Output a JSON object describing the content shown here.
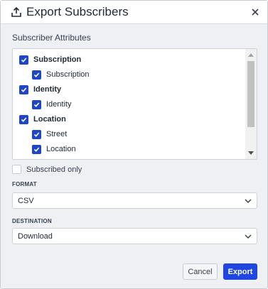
{
  "dialog": {
    "title": "Export Subscribers",
    "title_icon": "export-upload-icon",
    "close_icon": "close-icon"
  },
  "attributes": {
    "label": "Subscriber Attributes",
    "items": [
      {
        "label": "Subscription",
        "checked": true,
        "level": "group"
      },
      {
        "label": "Subscription",
        "checked": true,
        "level": "child"
      },
      {
        "label": "Identity",
        "checked": true,
        "level": "group"
      },
      {
        "label": "Identity",
        "checked": true,
        "level": "child"
      },
      {
        "label": "Location",
        "checked": true,
        "level": "group"
      },
      {
        "label": "Street",
        "checked": true,
        "level": "child"
      },
      {
        "label": "Location",
        "checked": true,
        "level": "child"
      }
    ]
  },
  "subscribed_only": {
    "label": "Subscribed only",
    "checked": false
  },
  "format": {
    "label": "FORMAT",
    "value": "CSV"
  },
  "destination": {
    "label": "DESTINATION",
    "value": "Download"
  },
  "buttons": {
    "cancel": "Cancel",
    "export": "Export"
  },
  "colors": {
    "accent": "#1f46e0",
    "background": "#eef0f4"
  }
}
